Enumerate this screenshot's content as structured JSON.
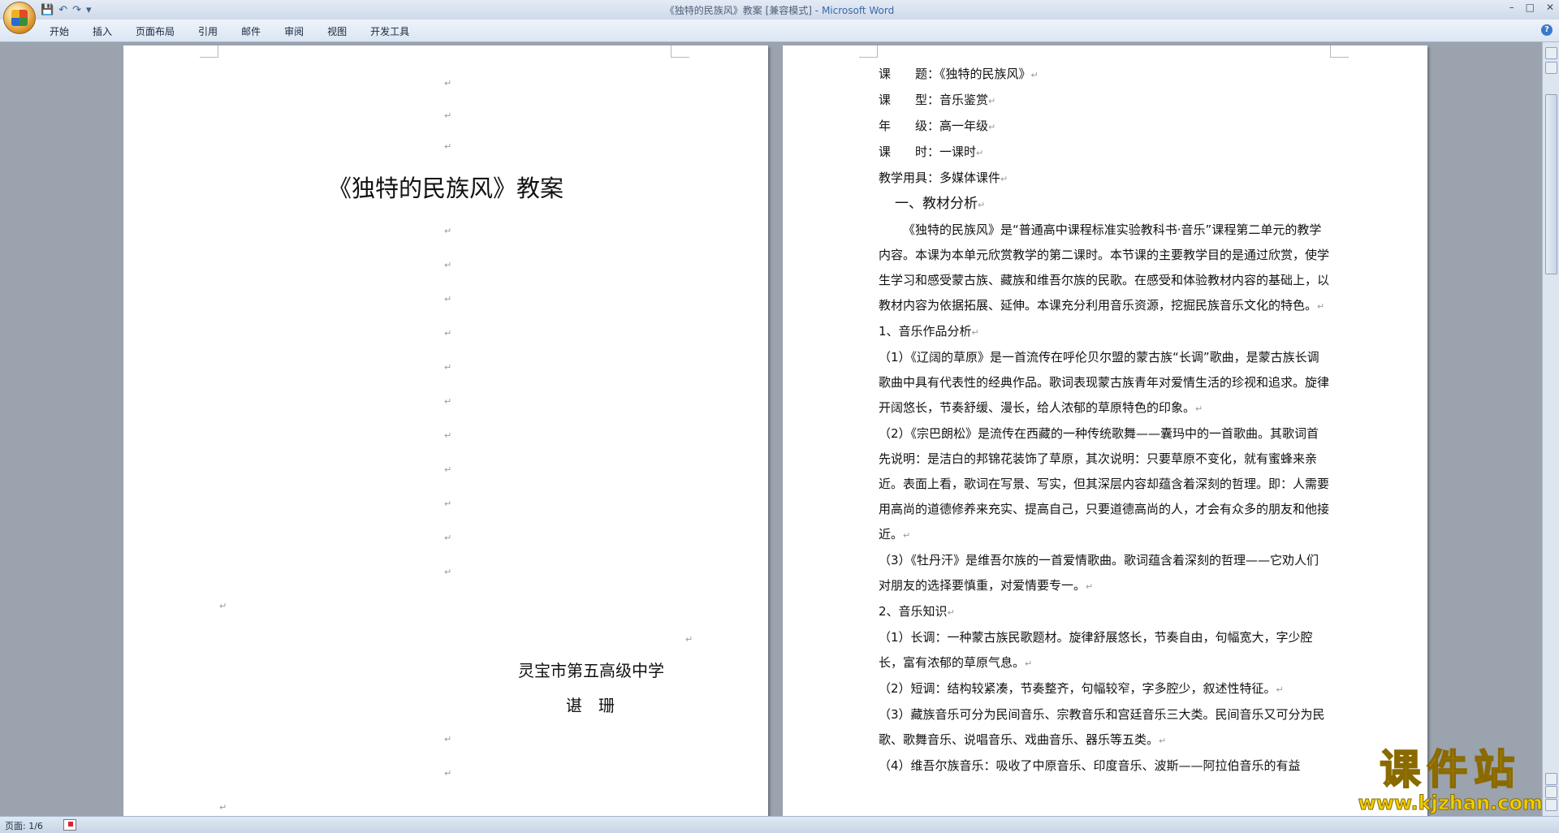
{
  "window": {
    "title": "《独特的民族风》教案 [兼容模式]",
    "app_name": "Microsoft Word",
    "controls": [
      "–",
      "□",
      "✕"
    ]
  },
  "quick_access": [
    "save",
    "undo",
    "redo",
    "customize"
  ],
  "ribbon": {
    "tabs": [
      "开始",
      "插入",
      "页面布局",
      "引用",
      "邮件",
      "审阅",
      "视图",
      "开发工具"
    ],
    "help": "?"
  },
  "left_page": {
    "title": "《独特的民族风》教案",
    "school": "灵宝市第五高级中学",
    "author": "谌　珊",
    "paragraph_mark": "↵"
  },
  "right_page": {
    "info": [
      "课　　题：《独特的民族风》",
      "课　　型：音乐鉴赏",
      "年　　级：高一年级",
      "课　　时：一课时",
      "教学用具：多媒体课件"
    ],
    "section1_heading": "一、教材分析",
    "intro": "《独特的民族风》是“普通高中课程标准实验教科书·音乐”课程第二单元的教学内容。本课为本单元欣赏教学的第二课时。本节课的主要教学目的是通过欣赏，使学生学习和感受蒙古族、藏族和维吾尔族的民歌。在感受和体验教材内容的基础上，以教材内容为依据拓展、延伸。本课充分利用音乐资源，挖掘民族音乐文化的特色。",
    "sub1_heading": "1、音乐作品分析",
    "works": [
      "（1）《辽阔的草原》是一首流传在呼伦贝尔盟的蒙古族“长调”歌曲，是蒙古族长调歌曲中具有代表性的经典作品。歌词表现蒙古族青年对爱情生活的珍视和追求。旋律开阔悠长，节奏舒缓、漫长，给人浓郁的草原特色的印象。",
      "（2）《宗巴朗松》是流传在西藏的一种传统歌舞——囊玛中的一首歌曲。其歌词首先说明：是洁白的邦锦花装饰了草原，其次说明：只要草原不变化，就有蜜蜂来亲近。表面上看，歌词在写景、写实，但其深层内容却蕴含着深刻的哲理。即：人需要用高尚的道德修养来充实、提高自己，只要道德高尚的人，才会有众多的朋友和他接近。",
      "（3）《牡丹汗》是维吾尔族的一首爱情歌曲。歌词蕴含着深刻的哲理——它劝人们对朋友的选择要慎重，对爱情要专一。"
    ],
    "sub2_heading": "2、音乐知识",
    "knowledge": [
      "（1）长调：一种蒙古族民歌题材。旋律舒展悠长，节奏自由，句幅宽大，字少腔长，富有浓郁的草原气息。",
      "（2）短调：结构较紧凑，节奏整齐，句幅较窄，字多腔少，叙述性特征。",
      "（3）藏族音乐可分为民间音乐、宗教音乐和宫廷音乐三大类。民间音乐又可分为民歌、歌舞音乐、说唱音乐、戏曲音乐、器乐等五类。",
      "（4）维吾尔族音乐：吸收了中原音乐、印度音乐、波斯——阿拉伯音乐的有益"
    ]
  },
  "status": {
    "page": "页面: 1/6"
  },
  "watermark": {
    "main": "课件站",
    "url": "www.kjzhan.com"
  }
}
